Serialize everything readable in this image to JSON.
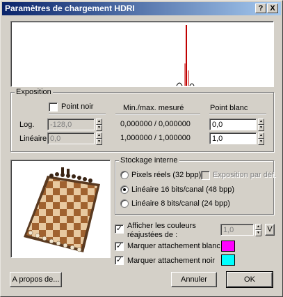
{
  "window": {
    "title": "Paramètres de chargement HDRI",
    "help_button": "?",
    "close_button": "X"
  },
  "exposure": {
    "group_label": "Exposition",
    "point_noir_label": "Point noir",
    "point_noir_checked": false,
    "minmax_header": "Min./max. mesuré",
    "point_blanc_header": "Point blanc",
    "log_label": "Log.",
    "log_black_value": "-128,0",
    "log_minmax": "0,000000 / 0,000000",
    "log_white_value": "0,0",
    "linear_label": "Linéaire",
    "linear_black_value": "0,0",
    "linear_minmax": "1,000000 / 1,000000",
    "linear_white_value": "1,0"
  },
  "storage": {
    "group_label": "Stockage interne",
    "options": [
      {
        "label": "Pixels réels (32 bpp)",
        "selected": false
      },
      {
        "label": "Linéaire 16 bits/canal (48 bpp)",
        "selected": true
      },
      {
        "label": "Linéaire 8 bits/canal (24 bpp)",
        "selected": false
      }
    ],
    "default_exposure_label": "Exposition par déf.",
    "default_exposure_checked": false
  },
  "adjust": {
    "label_line1": "Afficher les couleurs",
    "label_line2": "réajustées de :",
    "checked": true,
    "value": "1,0",
    "v_button": "V"
  },
  "mark_white": {
    "label": "Marquer attachement blanc",
    "checked": true,
    "color": "#ff00ff"
  },
  "mark_black": {
    "label": "Marquer attachement noir",
    "checked": true,
    "color": "#00ffff"
  },
  "buttons": {
    "about": "A propos de...",
    "cancel": "Annuler",
    "ok": "OK"
  },
  "colors": {
    "histogram_peak": "#c00000",
    "histogram_base": "#000000"
  }
}
